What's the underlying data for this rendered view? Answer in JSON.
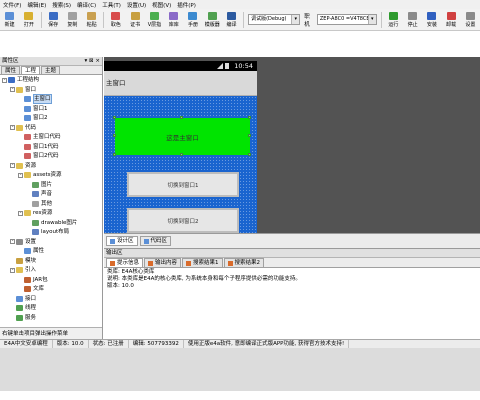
{
  "menu": [
    "文件(F)",
    "编辑(E)",
    "搜索(S)",
    "编译(C)",
    "工具(T)",
    "设置(U)",
    "视图(V)",
    "插件(P)"
  ],
  "toolbar": {
    "buttons": [
      {
        "label": "新建",
        "color": "#5b8fd6"
      },
      {
        "label": "打开",
        "color": "#d8b030"
      },
      {
        "label": "保存",
        "color": "#3a6cc4"
      },
      {
        "label": "复制",
        "color": "#a0a0a0"
      },
      {
        "label": "粘贴",
        "color": "#c9a050"
      },
      {
        "label": "取色",
        "color": "#d84c4c"
      },
      {
        "label": "证书",
        "color": "#c8a040"
      },
      {
        "label": "V层指",
        "color": "#4caf50"
      },
      {
        "label": "库库",
        "color": "#8a6ac8"
      },
      {
        "label": "手册",
        "color": "#3c8ad0"
      },
      {
        "label": "模版器",
        "color": "#50a050"
      },
      {
        "label": "编译",
        "color": "#2c5aa0"
      }
    ],
    "mode_combo": "调试版(Debug)",
    "device_label": "职机",
    "device_combo": "ZEP-A8C0 =V4T8CE",
    "right_buttons": [
      {
        "label": "运行",
        "color": "#2e9a2e"
      },
      {
        "label": "停止",
        "color": "#8a8a8a"
      },
      {
        "label": "安装",
        "color": "#3060c0"
      },
      {
        "label": "卸载",
        "color": "#d04040"
      },
      {
        "label": "设置",
        "color": "#8a8a8a"
      }
    ]
  },
  "left_panel": {
    "title": "属性区",
    "controls": "▾ ⊠ ×",
    "tabs": [
      "属性",
      "工程",
      "主题"
    ],
    "tree": [
      {
        "label": "工程结构",
        "indent": 0,
        "exp": "-",
        "icon": "#3a6cc4"
      },
      {
        "label": "窗口",
        "indent": 1,
        "exp": "-",
        "icon": "#e0c050"
      },
      {
        "label": "主窗口",
        "indent": 2,
        "exp": "",
        "icon": "#5b8fd6",
        "selected": true
      },
      {
        "label": "窗口1",
        "indent": 2,
        "exp": "",
        "icon": "#5b8fd6"
      },
      {
        "label": "窗口2",
        "indent": 2,
        "exp": "",
        "icon": "#5b8fd6"
      },
      {
        "label": "代码",
        "indent": 1,
        "exp": "-",
        "icon": "#e0c050"
      },
      {
        "label": "主窗口代码",
        "indent": 2,
        "exp": "",
        "icon": "#d06060"
      },
      {
        "label": "窗口1代码",
        "indent": 2,
        "exp": "",
        "icon": "#d06060"
      },
      {
        "label": "窗口2代码",
        "indent": 2,
        "exp": "",
        "icon": "#d06060"
      },
      {
        "label": "资源",
        "indent": 1,
        "exp": "-",
        "icon": "#e0c050"
      },
      {
        "label": "assets资源",
        "indent": 2,
        "exp": "-",
        "icon": "#e0c050"
      },
      {
        "label": "图片",
        "indent": 3,
        "exp": "",
        "icon": "#60a060"
      },
      {
        "label": "声音",
        "indent": 3,
        "exp": "",
        "icon": "#6080c0"
      },
      {
        "label": "其他",
        "indent": 3,
        "exp": "",
        "icon": "#a0a0a0"
      },
      {
        "label": "res资源",
        "indent": 2,
        "exp": "-",
        "icon": "#e0c050"
      },
      {
        "label": "drawable图片",
        "indent": 3,
        "exp": "",
        "icon": "#60a060"
      },
      {
        "label": "layout布局",
        "indent": 3,
        "exp": "",
        "icon": "#6080c0"
      },
      {
        "label": "设置",
        "indent": 1,
        "exp": "-",
        "icon": "#8a8a8a"
      },
      {
        "label": "属性",
        "indent": 2,
        "exp": "",
        "icon": "#5b8fd6"
      },
      {
        "label": "模块",
        "indent": 1,
        "exp": "",
        "icon": "#c8a040"
      },
      {
        "label": "引入",
        "indent": 1,
        "exp": "-",
        "icon": "#e0c050"
      },
      {
        "label": "JAR包",
        "indent": 2,
        "exp": "",
        "icon": "#c06030"
      },
      {
        "label": "文库",
        "indent": 2,
        "exp": "",
        "icon": "#c06030"
      },
      {
        "label": "接口",
        "indent": 1,
        "exp": "",
        "icon": "#5b8fd6"
      },
      {
        "label": "线程",
        "indent": 1,
        "exp": "",
        "icon": "#50a050"
      },
      {
        "label": "服务",
        "indent": 1,
        "exp": "",
        "icon": "#50a050"
      }
    ],
    "status": "右键单击项目弹出操作菜单"
  },
  "phone": {
    "time": "10:54",
    "title": "主窗口",
    "green_label": "这是主窗口",
    "buttons": [
      "切换到窗口1",
      "切换到窗口2"
    ],
    "colors": {
      "canvas": "#1a64cf",
      "green": "#00e400"
    }
  },
  "design_tabs": [
    "设计区",
    "代码区"
  ],
  "output": {
    "title": "输出区",
    "tabs": [
      "提示信息",
      "输出内容",
      "搜索结果1",
      "搜索结果2"
    ],
    "lines": [
      "类库: E4A核心类库",
      "说明: 本类库是E4A的核心类库, 为系统本身和每个子程序提供必需的功能支持。",
      "版本: 10.0"
    ]
  },
  "statusbar": [
    "E4A中文安卓编程",
    "版本: 10.0",
    "状态: 已注册",
    "编辑: 507793392",
    "使用正版e4a软件, 意即编译正式版APP功能, 获得官方技术支持!"
  ]
}
